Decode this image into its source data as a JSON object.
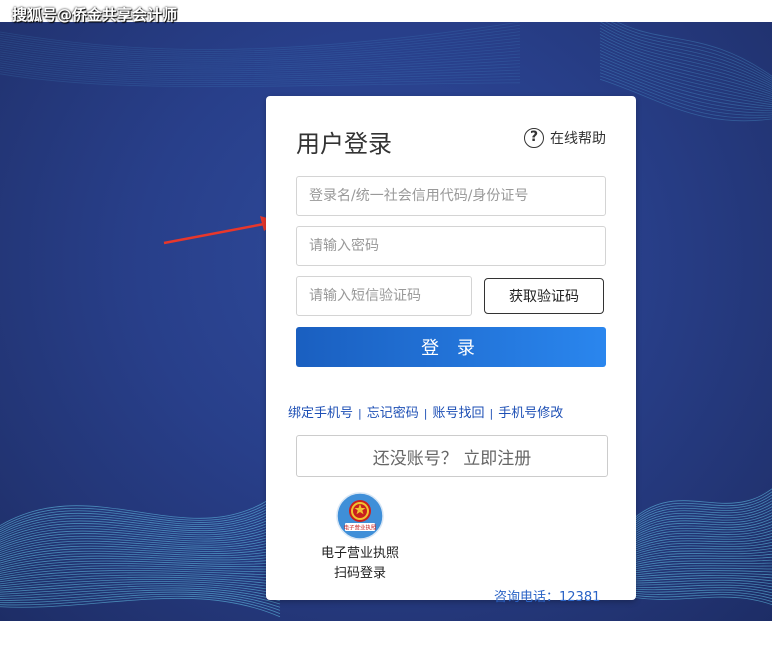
{
  "watermark": "搜狐号@侨金共享会计师",
  "login": {
    "title": "用户登录",
    "help_label": "在线帮助",
    "help_icon_glyph": "?",
    "username_placeholder": "登录名/统一社会信用代码/身份证号",
    "password_placeholder": "请输入密码",
    "sms_placeholder": "请输入短信验证码",
    "sms_button": "获取验证码",
    "submit_button": "登 录",
    "links": [
      "绑定手机号",
      "忘记密码",
      "账号找回",
      "手机号修改"
    ],
    "link_separator": "|",
    "register_button": "还没账号？ 立即注册",
    "license_line1": "电子营业执照",
    "license_line2": "扫码登录",
    "emblem_text": "电子营业执照",
    "hotline": "咨询电话：12381"
  },
  "colors": {
    "accent_blue": "#2a86ee",
    "link_blue": "#1d4fb5",
    "background_navy": "#283f8a",
    "arrow_red": "#e8372b"
  },
  "icons": {
    "help": "question-circle-icon",
    "emblem": "national-emblem-icon",
    "arrow": "red-arrow-pointer"
  }
}
